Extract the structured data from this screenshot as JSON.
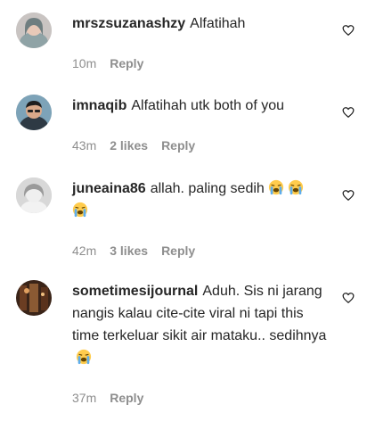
{
  "comments": [
    {
      "username": "mrszsuzanashzy",
      "text": "Alfatihah",
      "time": "10m",
      "likes": "",
      "reply": "Reply",
      "emoji_count": 0
    },
    {
      "username": "imnaqib",
      "text": "Alfatihah utk both of you",
      "time": "43m",
      "likes": "2 likes",
      "reply": "Reply",
      "emoji_count": 0
    },
    {
      "username": "juneaina86",
      "text": "allah. paling sedih",
      "time": "42m",
      "likes": "3 likes",
      "reply": "Reply",
      "emoji_count": 3
    },
    {
      "username": "sometimesijournal",
      "text": "Aduh. Sis ni jarang nangis kalau cite-cite viral ni tapi this time terkeluar sikit air mataku.. sedihnya",
      "time": "37m",
      "likes": "",
      "reply": "Reply",
      "emoji_count": 1
    }
  ],
  "icons": {
    "like": "heart-icon",
    "emoji": "loudly-crying-face-emoji"
  },
  "colors": {
    "text": "#262626",
    "secondary": "#8e8e8e",
    "background": "#ffffff"
  }
}
